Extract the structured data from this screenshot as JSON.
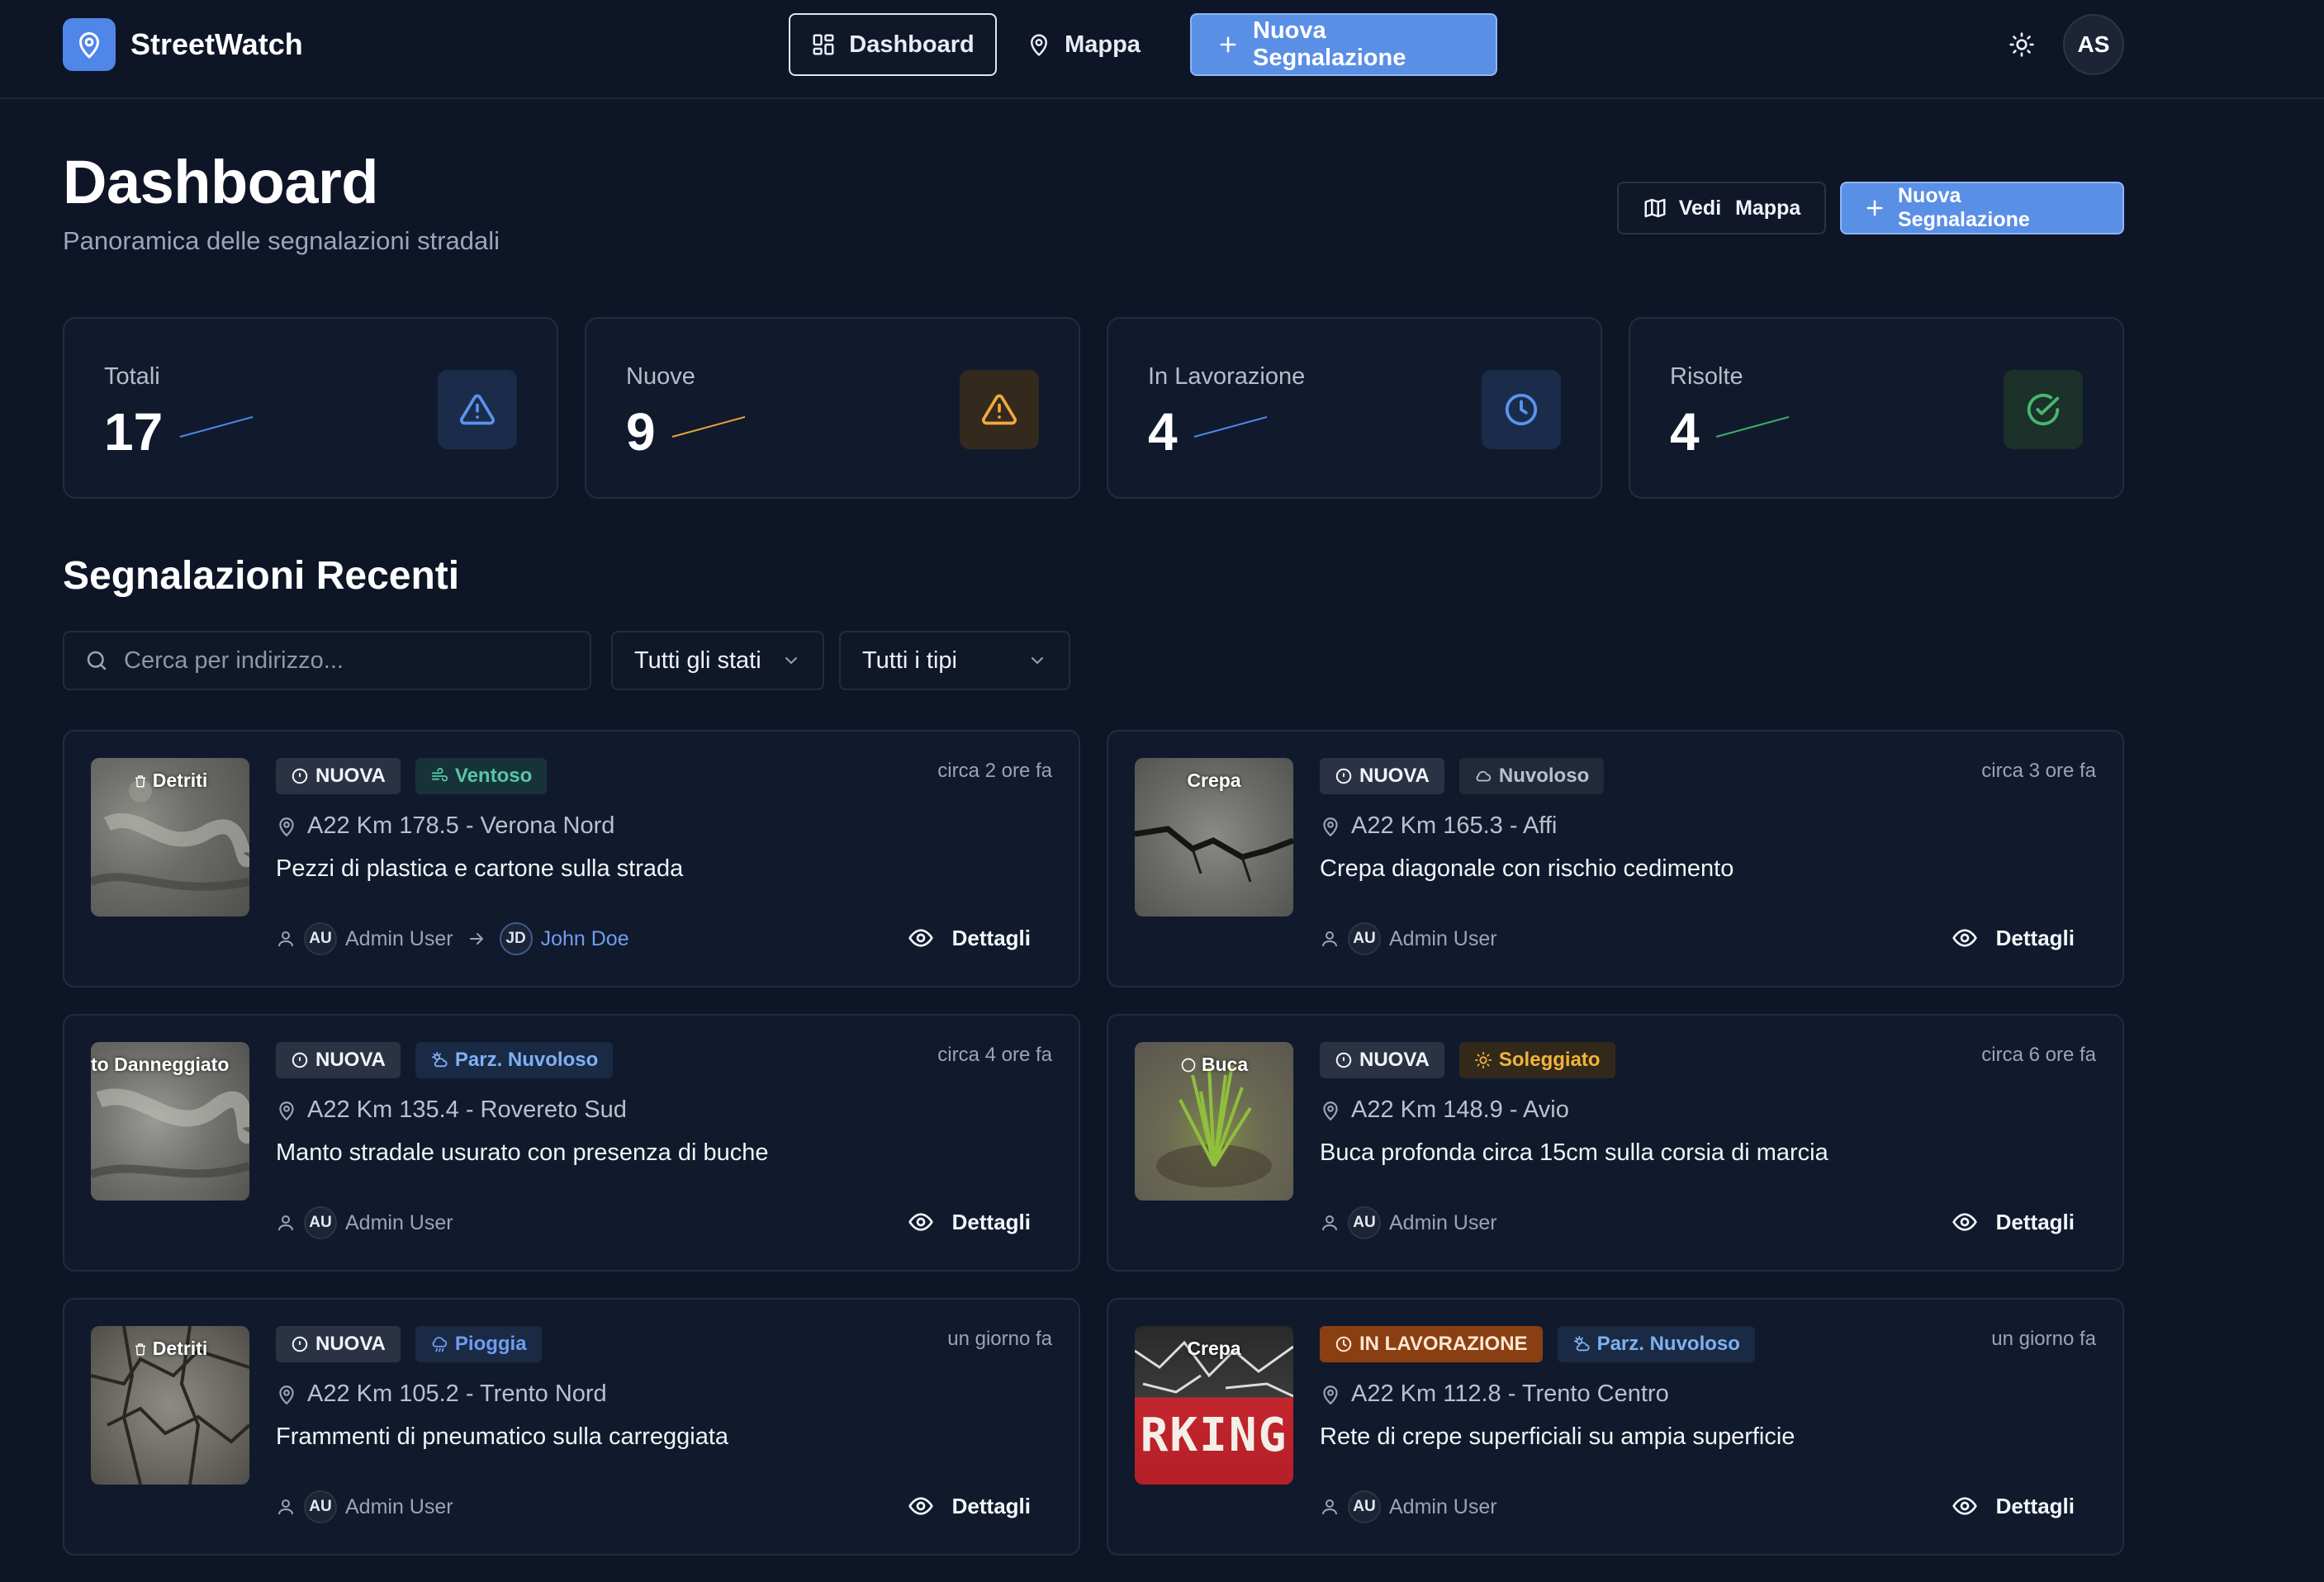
{
  "app": {
    "name": "StreetWatch",
    "user_initials": "AS"
  },
  "nav": {
    "dashboard": "Dashboard",
    "mappa": "Mappa",
    "nuova": "Nuova Segnalazione"
  },
  "header": {
    "title": "Dashboard",
    "subtitle": "Panoramica delle segnalazioni stradali",
    "vedi_mappa": "Vedi Mappa",
    "nuova": "Nuova Segnalazione"
  },
  "stats": [
    {
      "label": "Totali",
      "value": "17",
      "color": "#4f86e8"
    },
    {
      "label": "Nuove",
      "value": "9",
      "color": "#e8a33a"
    },
    {
      "label": "In Lavorazione",
      "value": "4",
      "color": "#4f86e8"
    },
    {
      "label": "Risolte",
      "value": "4",
      "color": "#3fae6a"
    }
  ],
  "section": {
    "title": "Segnalazioni Recenti",
    "search_placeholder": "Cerca per indirizzo...",
    "filter_stati": "Tutti gli stati",
    "filter_tipi": "Tutti i tipi"
  },
  "details_label": "Dettagli",
  "reports": [
    {
      "thumb": "Detriti",
      "status": "NUOVA",
      "weather": "Ventoso",
      "weather_color": "#56c7a3",
      "weather_bg": "#18323a",
      "time": "circa 2 ore fa",
      "address": "A22 Km 178.5 - Verona Nord",
      "desc": "Pezzi di plastica e cartone sulla strada",
      "author_initials": "AU",
      "author": "Admin User",
      "assignee_initials": "JD",
      "assignee": "John Doe"
    },
    {
      "thumb": "Crepa",
      "status": "NUOVA",
      "weather": "Nuvoloso",
      "weather_color": "#b7c0cf",
      "weather_bg": "#222a3a",
      "time": "circa 3 ore fa",
      "address": "A22 Km 165.3 - Affi",
      "desc": "Crepa diagonale con rischio cedimento",
      "author_initials": "AU",
      "author": "Admin User"
    },
    {
      "thumb": "to Danneggiato",
      "status": "NUOVA",
      "weather": "Parz. Nuvoloso",
      "weather_color": "#7fb0f2",
      "weather_bg": "#1a2a44",
      "time": "circa 4 ore fa",
      "address": "A22 Km 135.4 - Rovereto Sud",
      "desc": "Manto stradale usurato con presenza di buche",
      "author_initials": "AU",
      "author": "Admin User"
    },
    {
      "thumb": "Buca",
      "status": "NUOVA",
      "weather": "Soleggiato",
      "weather_color": "#f0b43c",
      "weather_bg": "#33291a",
      "time": "circa 6 ore fa",
      "address": "A22 Km 148.9 - Avio",
      "desc": "Buca profonda circa 15cm sulla corsia di marcia",
      "author_initials": "AU",
      "author": "Admin User"
    },
    {
      "thumb": "Detriti",
      "status": "NUOVA",
      "weather": "Pioggia",
      "weather_color": "#6f9cf0",
      "weather_bg": "#1a2a44",
      "time": "un giorno fa",
      "address": "A22 Km 105.2 - Trento Nord",
      "desc": "Frammenti di pneumatico sulla carreggiata",
      "author_initials": "AU",
      "author": "Admin User"
    },
    {
      "thumb": "Crepa",
      "status": "IN LAVORAZIONE",
      "weather": "Parz. Nuvoloso",
      "weather_color": "#7fb0f2",
      "weather_bg": "#1a2a44",
      "time": "un giorno fa",
      "address": "A22 Km 112.8 - Trento Centro",
      "desc": "Rete di crepe superficiali su ampia superficie",
      "author_initials": "AU",
      "author": "Admin User",
      "thumb_text": "RKING"
    }
  ]
}
